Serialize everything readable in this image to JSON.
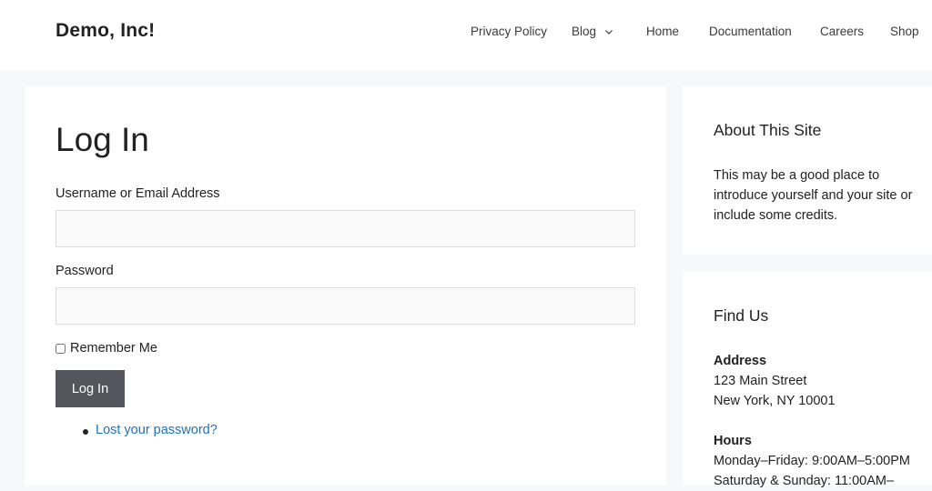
{
  "header": {
    "site_title": "Demo, Inc!",
    "nav": [
      {
        "label": "Privacy Policy"
      },
      {
        "label": "Blog",
        "has_dropdown": true
      },
      {
        "label": "Home"
      },
      {
        "label": "Documentation"
      },
      {
        "label": "Careers"
      },
      {
        "label": "Shop"
      }
    ]
  },
  "login": {
    "title": "Log In",
    "username_label": "Username or Email Address",
    "username_value": "",
    "password_label": "Password",
    "password_value": "",
    "remember_label": "Remember Me",
    "remember_checked": false,
    "submit_label": "Log In",
    "lost_password_link": "Lost your password?"
  },
  "sidebar": {
    "about": {
      "title": "About This Site",
      "text": "This may be a good place to introduce yourself and your site or include some credits."
    },
    "find_us": {
      "title": "Find Us",
      "address_heading": "Address",
      "address_line1": "123 Main Street",
      "address_line2": "New York, NY 10001",
      "hours_heading": "Hours",
      "hours_line1": "Monday–Friday: 9:00AM–5:00PM",
      "hours_line2": "Saturday & Sunday: 11:00AM–"
    }
  },
  "colors": {
    "page_background": "#f7f8f9",
    "button_background": "#55555e",
    "link": "#1e73be"
  }
}
